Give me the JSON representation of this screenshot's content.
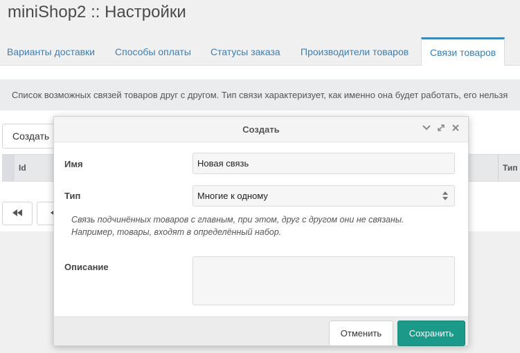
{
  "page": {
    "title": "miniShop2 :: Настройки"
  },
  "tabs": [
    {
      "label": "Варианты доставки"
    },
    {
      "label": "Способы оплаты"
    },
    {
      "label": "Статусы заказа"
    },
    {
      "label": "Производители товаров"
    },
    {
      "label": "Связи товаров"
    }
  ],
  "active_tab": "Связи товаров",
  "panel": {
    "description": "Список возможных связей товаров друг с другом. Тип связи характеризует, как именно она будет работать, его нельзя",
    "create_button": "Создать",
    "grid_columns": {
      "id": "Id",
      "type": "Тип"
    }
  },
  "modal": {
    "title": "Создать",
    "fields": {
      "name": {
        "label": "Имя",
        "value": "Новая связь"
      },
      "type": {
        "label": "Тип",
        "value": "Многие к одному"
      },
      "description": {
        "label": "Описание",
        "value": ""
      }
    },
    "hint_line1": "Связь подчинённых товаров с главным, при этом, друг с другом они не связаны.",
    "hint_line2": "Например, товары, входят в определённый набор.",
    "cancel_label": "Отменить",
    "save_label": "Сохранить"
  },
  "colors": {
    "accent": "#1b9a89",
    "link": "#3a7fb3"
  }
}
